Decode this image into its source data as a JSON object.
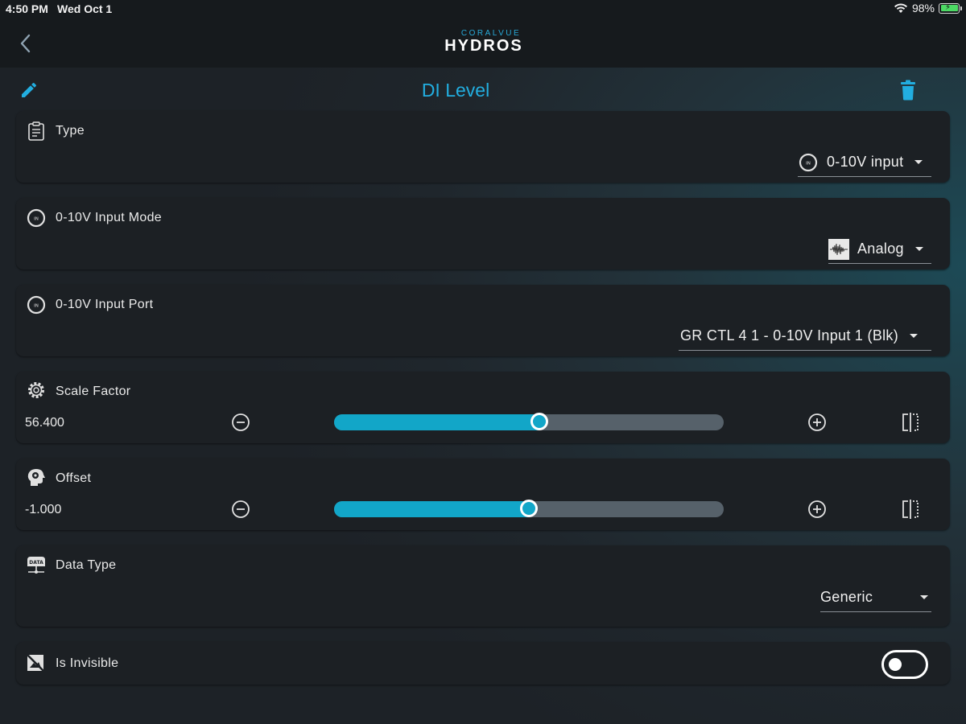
{
  "status_bar": {
    "time": "4:50 PM",
    "date": "Wed Oct 1",
    "battery": "98%"
  },
  "header": {
    "brand_top": "CORALVUE",
    "brand_main": "HYDROS"
  },
  "page": {
    "title": "DI Level"
  },
  "fields": {
    "type": {
      "label": "Type",
      "value": "0-10V input",
      "icon": "clipboard-icon"
    },
    "input_mode": {
      "label": "0-10V Input Mode",
      "value": "Analog",
      "icon": "input-port-icon"
    },
    "input_port": {
      "label": "0-10V Input Port",
      "value": "GR CTL 4 1 - 0-10V Input 1 (Blk)",
      "icon": "input-port-icon"
    },
    "scale_factor": {
      "label": "Scale Factor",
      "value": "56.400",
      "slider_fraction": 0.526,
      "icon": "gear-icon"
    },
    "offset": {
      "label": "Offset",
      "value": "-1.000",
      "slider_fraction": 0.5,
      "icon": "head-gear-icon"
    },
    "data_type": {
      "label": "Data Type",
      "value": "Generic",
      "icon": "data-icon"
    },
    "is_invisible": {
      "label": "Is Invisible",
      "value": false,
      "icon": "invisible-image-icon"
    }
  },
  "colors": {
    "accent": "#22aee0",
    "slider_fill": "#12a6c8",
    "slider_track": "#56616a",
    "card": "#1c2024"
  }
}
